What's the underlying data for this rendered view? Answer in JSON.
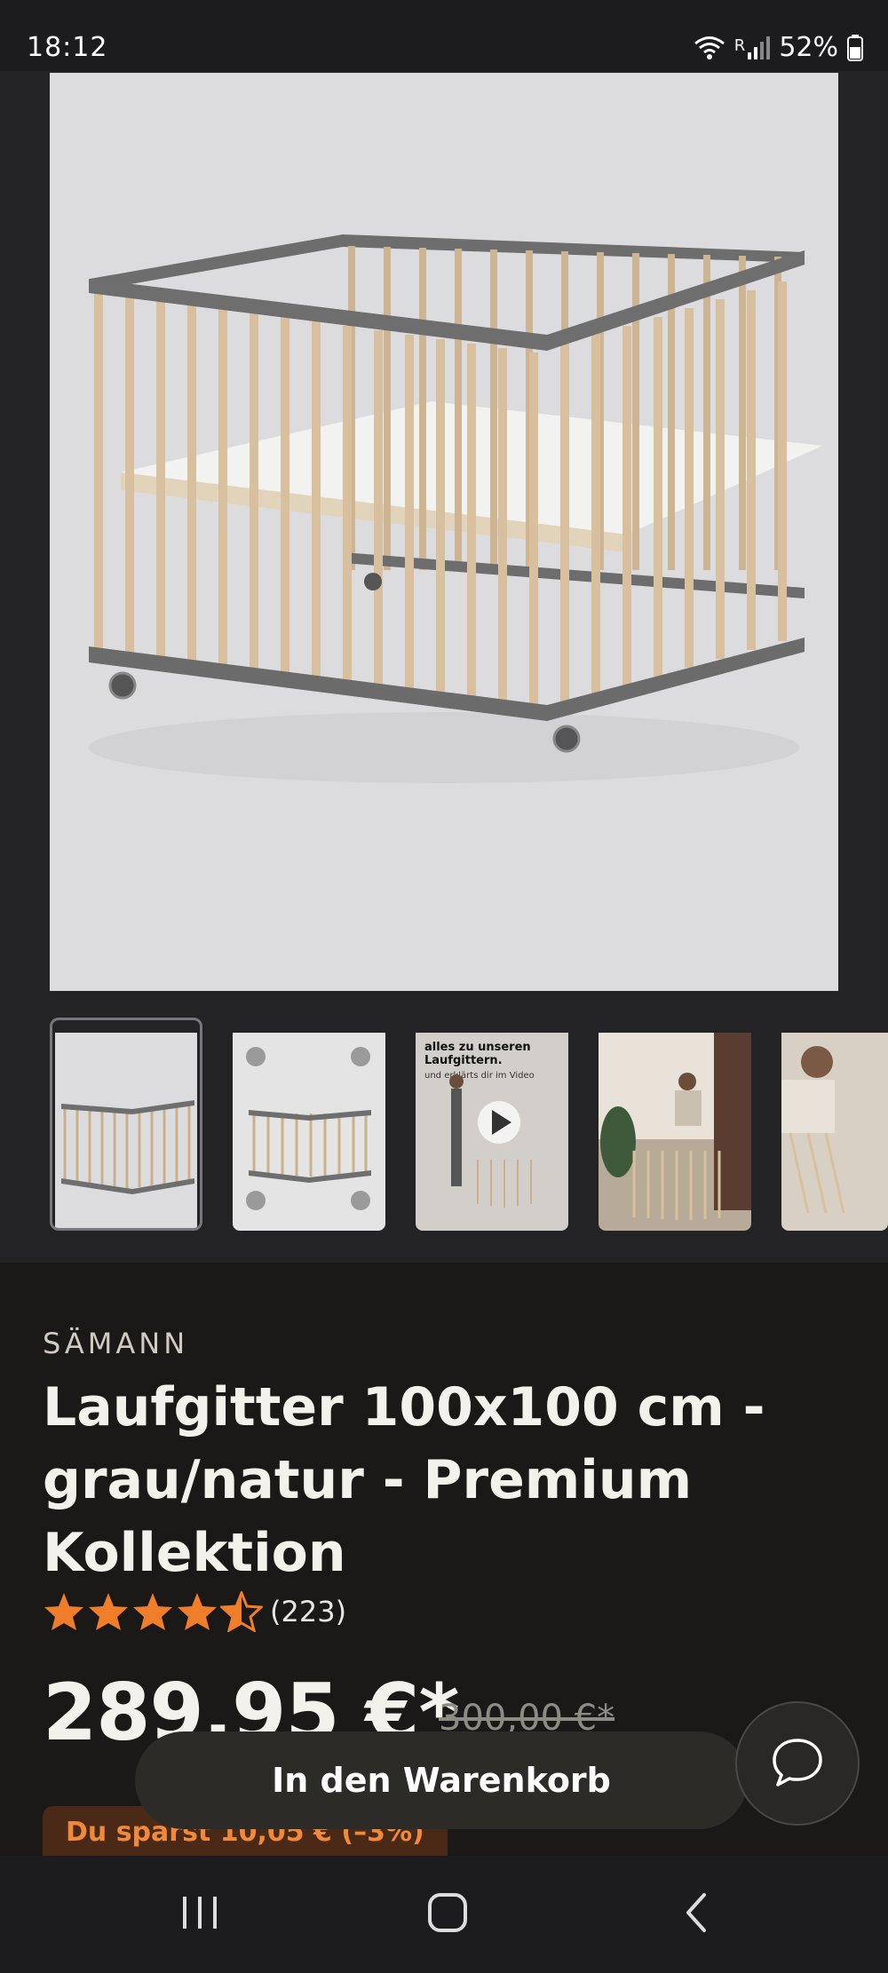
{
  "status_bar": {
    "time": "18:12",
    "network": "R",
    "battery": "52%"
  },
  "media": {
    "hero_alt": "Laufgitter",
    "thumbnails": [
      {
        "label": "",
        "active": true
      },
      {
        "label": "",
        "active": false
      },
      {
        "label": "alles zu unseren Laufgittern.",
        "subtext": "und erklärts dir im Video",
        "active": false
      },
      {
        "label": "",
        "active": false
      },
      {
        "label": "",
        "active": false
      }
    ]
  },
  "product": {
    "brand": "SÄMANN",
    "title": "Laufgitter 100x100 cm - grau/natur - Premium Kollektion",
    "rating": 4.5,
    "rating_count": "(223)",
    "price": "289,95 €*",
    "old_price": "300,00 €*",
    "savings": "Du sparst 10,05 € (–3%)"
  },
  "actions": {
    "cart_label": "In den Warenkorb"
  },
  "colors": {
    "accent": "#f07d2a",
    "background": "#1a1918"
  }
}
